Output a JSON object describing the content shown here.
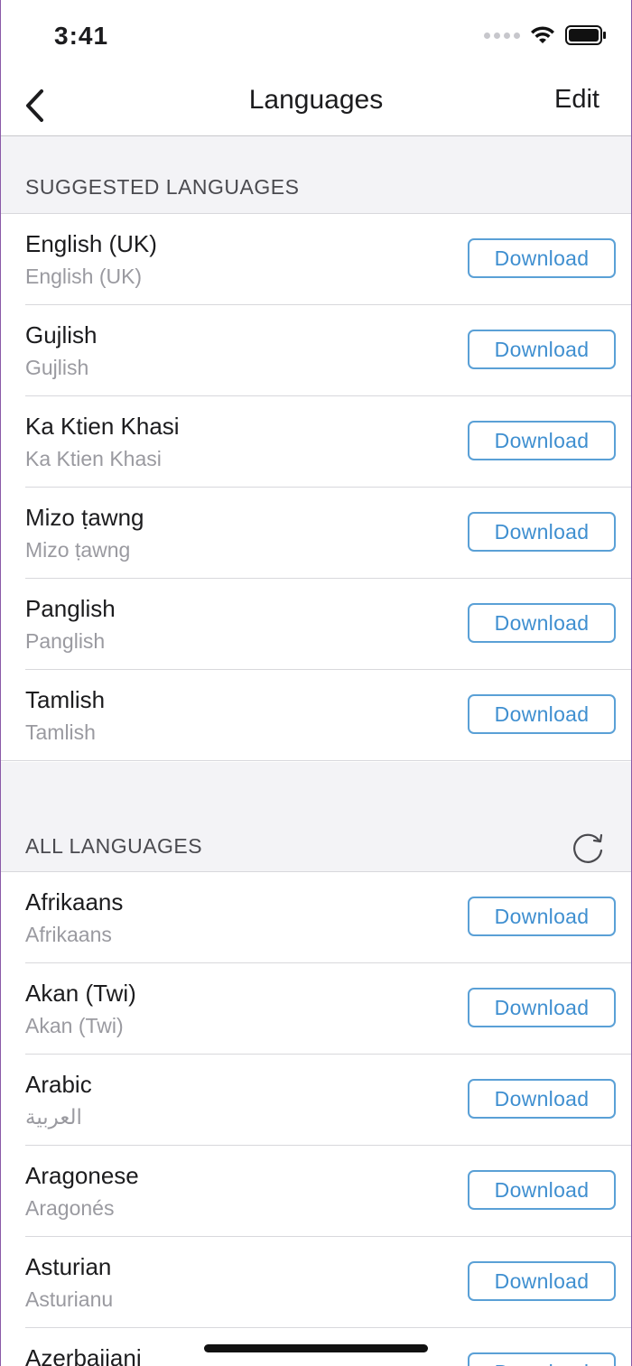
{
  "status": {
    "time": "3:41"
  },
  "nav": {
    "title": "Languages",
    "edit_label": "Edit"
  },
  "suggested": {
    "header": "SUGGESTED LANGUAGES",
    "items": [
      {
        "name": "English (UK)",
        "native": "English (UK)",
        "action": "Download"
      },
      {
        "name": "Gujlish",
        "native": "Gujlish",
        "action": "Download"
      },
      {
        "name": "Ka Ktien Khasi",
        "native": "Ka Ktien Khasi",
        "action": "Download"
      },
      {
        "name": "Mizo ṭawng",
        "native": "Mizo ṭawng",
        "action": "Download"
      },
      {
        "name": "Panglish",
        "native": "Panglish",
        "action": "Download"
      },
      {
        "name": "Tamlish",
        "native": "Tamlish",
        "action": "Download"
      }
    ]
  },
  "all": {
    "header": "ALL LANGUAGES",
    "items": [
      {
        "name": "Afrikaans",
        "native": "Afrikaans",
        "action": "Download"
      },
      {
        "name": "Akan (Twi)",
        "native": "Akan (Twi)",
        "action": "Download"
      },
      {
        "name": "Arabic",
        "native": "العربية",
        "action": "Download"
      },
      {
        "name": "Aragonese",
        "native": "Aragonés",
        "action": "Download"
      },
      {
        "name": "Asturian",
        "native": "Asturianu",
        "action": "Download"
      },
      {
        "name": "Azerbaijani",
        "native": "",
        "action": "Download"
      }
    ]
  },
  "icons": {
    "back": "chevron-left-icon",
    "refresh": "refresh-icon",
    "wifi": "wifi-icon",
    "battery": "battery-icon"
  },
  "colors": {
    "accent": "#3f8fd0",
    "section_bg": "#f3f3f6"
  }
}
